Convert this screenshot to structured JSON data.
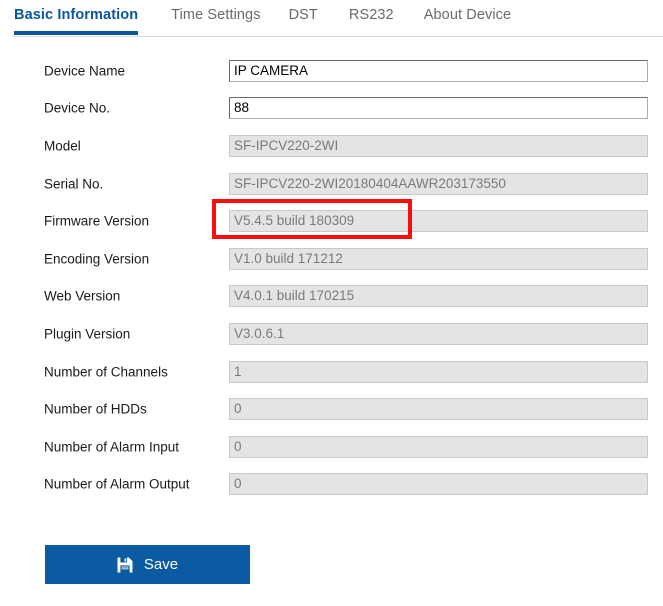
{
  "tabs": [
    {
      "label": "Basic Information",
      "active": true
    },
    {
      "label": "Time Settings",
      "active": false
    },
    {
      "label": "DST",
      "active": false
    },
    {
      "label": "RS232",
      "active": false
    },
    {
      "label": "About Device",
      "active": false
    }
  ],
  "form": {
    "rows": [
      {
        "label": "Device Name",
        "value": "IP CAMERA",
        "readonly": false
      },
      {
        "label": "Device No.",
        "value": "88",
        "readonly": false
      },
      {
        "label": "Model",
        "value": "SF-IPCV220-2WI",
        "readonly": true
      },
      {
        "label": "Serial No.",
        "value": "SF-IPCV220-2WI20180404AAWR203173550",
        "readonly": true
      },
      {
        "label": "Firmware Version",
        "value": "V5.4.5 build 180309",
        "readonly": true
      },
      {
        "label": "Encoding Version",
        "value": "V1.0 build 171212",
        "readonly": true
      },
      {
        "label": "Web Version",
        "value": "V4.0.1 build 170215",
        "readonly": true
      },
      {
        "label": "Plugin Version",
        "value": "V3.0.6.1",
        "readonly": true
      },
      {
        "label": "Number of Channels",
        "value": "1",
        "readonly": true
      },
      {
        "label": "Number of HDDs",
        "value": "0",
        "readonly": true
      },
      {
        "label": "Number of Alarm Input",
        "value": "0",
        "readonly": true
      },
      {
        "label": "Number of Alarm Output",
        "value": "0",
        "readonly": true
      }
    ]
  },
  "annotation": {
    "target_row_label": "Firmware Version",
    "color": "#fb0d0d"
  },
  "footer": {
    "save_label": "Save",
    "save_icon": "floppy-disk-save-icon"
  },
  "colors": {
    "accent": "#0a57a0",
    "button": "#0a5ba2",
    "readonly_field_bg": "#e4e4e4",
    "readonly_field_text": "#7a7a7a",
    "inactive_tab_text": "#6a6a6a"
  }
}
